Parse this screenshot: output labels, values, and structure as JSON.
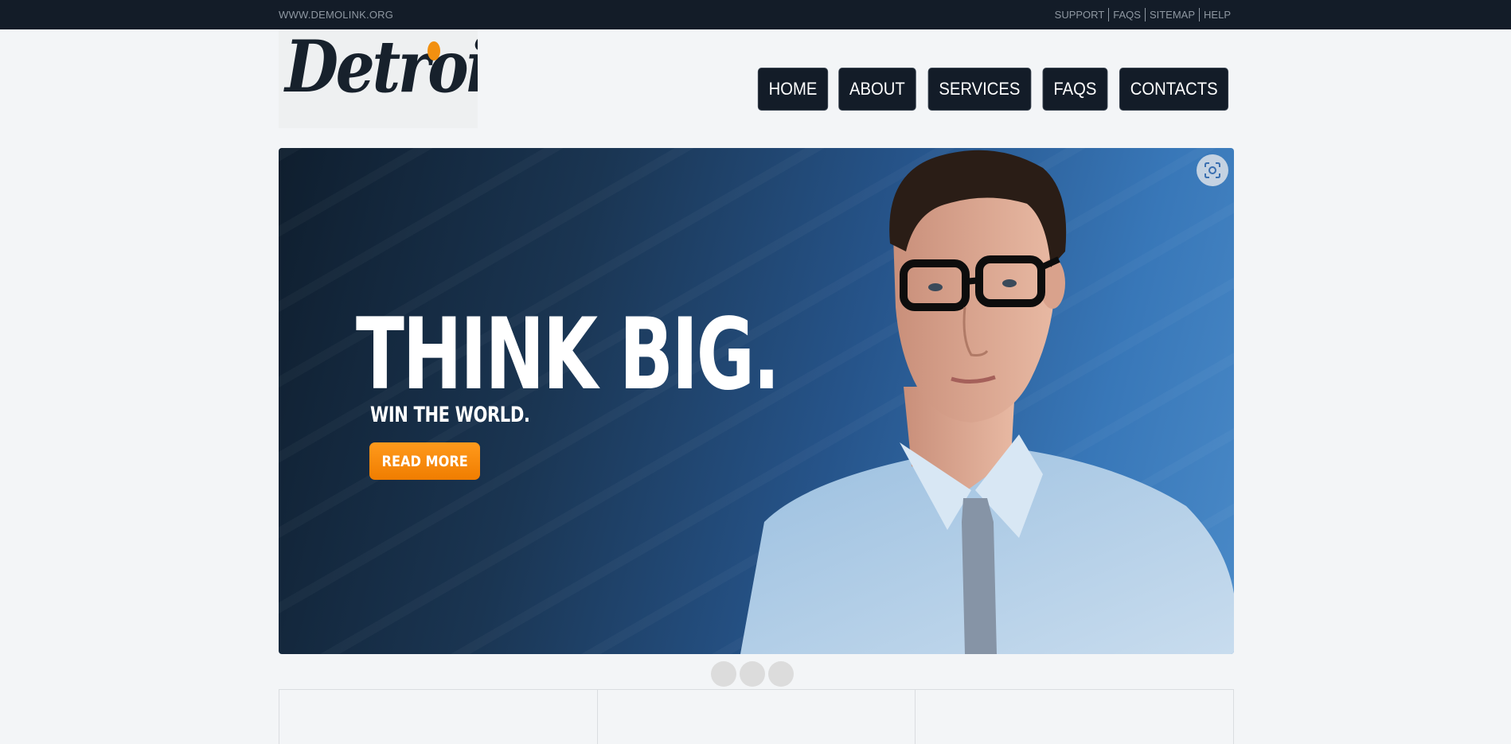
{
  "topbar": {
    "site": "WWW.DEMOLINK.ORG",
    "links": [
      "SUPPORT",
      "FAQS",
      "SITEMAP",
      "HELP"
    ]
  },
  "logo": {
    "text": "Detroix"
  },
  "nav": {
    "items": [
      "HOME",
      "ABOUT",
      "SERVICES",
      "FAQS",
      "CONTACTS"
    ]
  },
  "slider": {
    "headline": "THINK BIG.",
    "subline": "WIN THE WORLD.",
    "button": "READ MORE",
    "lens_icon": "visual-search-icon",
    "slide_count": 3
  },
  "colors": {
    "topbar": "#131c28",
    "nav_button": "#131c28",
    "accent": "#f29010",
    "page_bg": "#f3f5f7"
  }
}
